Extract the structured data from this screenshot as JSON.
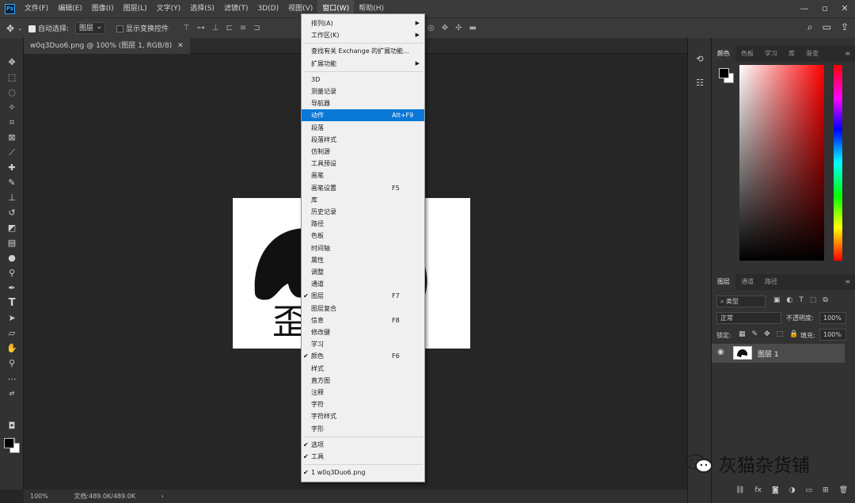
{
  "app": {
    "logo": "Ps",
    "menus": [
      "文件(F)",
      "编辑(E)",
      "图像(I)",
      "图层(L)",
      "文字(Y)",
      "选择(S)",
      "滤镜(T)",
      "3D(D)",
      "视图(V)",
      "窗口(W)",
      "帮助(H)"
    ]
  },
  "window_controls": {
    "minimize": "—",
    "restore": "▫",
    "close": "✕"
  },
  "options": {
    "auto_select_label": "自动选择:",
    "auto_select_value": "图层",
    "transform_label": "显示变换控件"
  },
  "document": {
    "tab_title": "w0q3Duo6.png @ 100% (图层 1, RGB/8)",
    "canvas_text": "歪",
    "zoom": "100%",
    "doc_size": "文档:489.0K/489.0K"
  },
  "window_menu": {
    "items": [
      {
        "label": "排列(A)",
        "arrow": "▶"
      },
      {
        "label": "工作区(K)",
        "arrow": "▶"
      },
      {
        "label": "查找有关 Exchange 的扩展功能..."
      },
      {
        "label": "扩展功能",
        "arrow": "▶"
      },
      {
        "label": "3D"
      },
      {
        "label": "测量记录"
      },
      {
        "label": "导航器"
      },
      {
        "label": "动作",
        "shortcut": "Alt+F9",
        "highlighted": true
      },
      {
        "label": "段落"
      },
      {
        "label": "段落样式"
      },
      {
        "label": "仿制源"
      },
      {
        "label": "工具预设"
      },
      {
        "label": "画笔"
      },
      {
        "label": "画笔设置",
        "shortcut": "F5"
      },
      {
        "label": "库"
      },
      {
        "label": "历史记录"
      },
      {
        "label": "路径"
      },
      {
        "label": "色板"
      },
      {
        "label": "时间轴"
      },
      {
        "label": "属性"
      },
      {
        "label": "调整"
      },
      {
        "label": "通道"
      },
      {
        "label": "图层",
        "shortcut": "F7",
        "checked": true
      },
      {
        "label": "图层复合"
      },
      {
        "label": "信息",
        "shortcut": "F8"
      },
      {
        "label": "修改键"
      },
      {
        "label": "学习"
      },
      {
        "label": "颜色",
        "shortcut": "F6",
        "checked": true
      },
      {
        "label": "样式"
      },
      {
        "label": "直方图"
      },
      {
        "label": "注释"
      },
      {
        "label": "字符"
      },
      {
        "label": "字符样式"
      },
      {
        "label": "字形"
      },
      {
        "label": "选项",
        "checked": true
      },
      {
        "label": "工具",
        "checked": true
      },
      {
        "label": "1 w0q3Duo6.png",
        "checked": true
      }
    ],
    "check": "✔"
  },
  "color_panel": {
    "tabs": [
      "颜色",
      "色板",
      "学习",
      "库",
      "渐变"
    ]
  },
  "layers_panel": {
    "tabs": [
      "图层",
      "通道",
      "路径"
    ],
    "filter": "类型",
    "blend_mode": "正常",
    "opacity_label": "不透明度:",
    "opacity": "100%",
    "lock_label": "锁定:",
    "fill_label": "填充:",
    "fill": "100%",
    "layer_name": "图层 1",
    "bottom_icons": [
      "link-icon",
      "fx-icon",
      "mask-icon",
      "adjustment-icon",
      "group-icon",
      "new-layer-icon",
      "trash-icon"
    ]
  },
  "watermark": {
    "text": "灰猫杂货铺"
  }
}
